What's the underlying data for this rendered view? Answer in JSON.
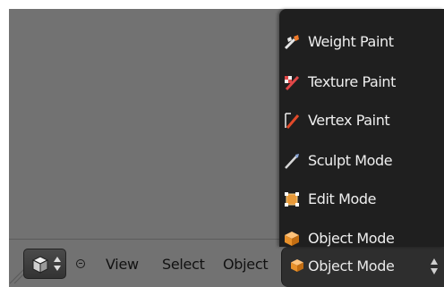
{
  "header": {
    "menus": {
      "view": "View",
      "select": "Select",
      "object": "Object"
    },
    "mode_selector": {
      "selected_label": "Object Mode"
    }
  },
  "mode_menu": {
    "items": [
      {
        "label": "Weight Paint",
        "icon": "weight-paint-icon"
      },
      {
        "label": "Texture Paint",
        "icon": "texture-paint-icon"
      },
      {
        "label": "Vertex Paint",
        "icon": "vertex-paint-icon"
      },
      {
        "label": "Sculpt Mode",
        "icon": "sculpt-mode-icon"
      },
      {
        "label": "Edit Mode",
        "icon": "edit-mode-icon"
      },
      {
        "label": "Object Mode",
        "icon": "object-mode-icon"
      }
    ]
  },
  "colors": {
    "viewport_bg": "#727272",
    "menu_bg": "#1f1f1f",
    "menu_text": "#eeeeee",
    "accent_orange": "#e8902a"
  }
}
